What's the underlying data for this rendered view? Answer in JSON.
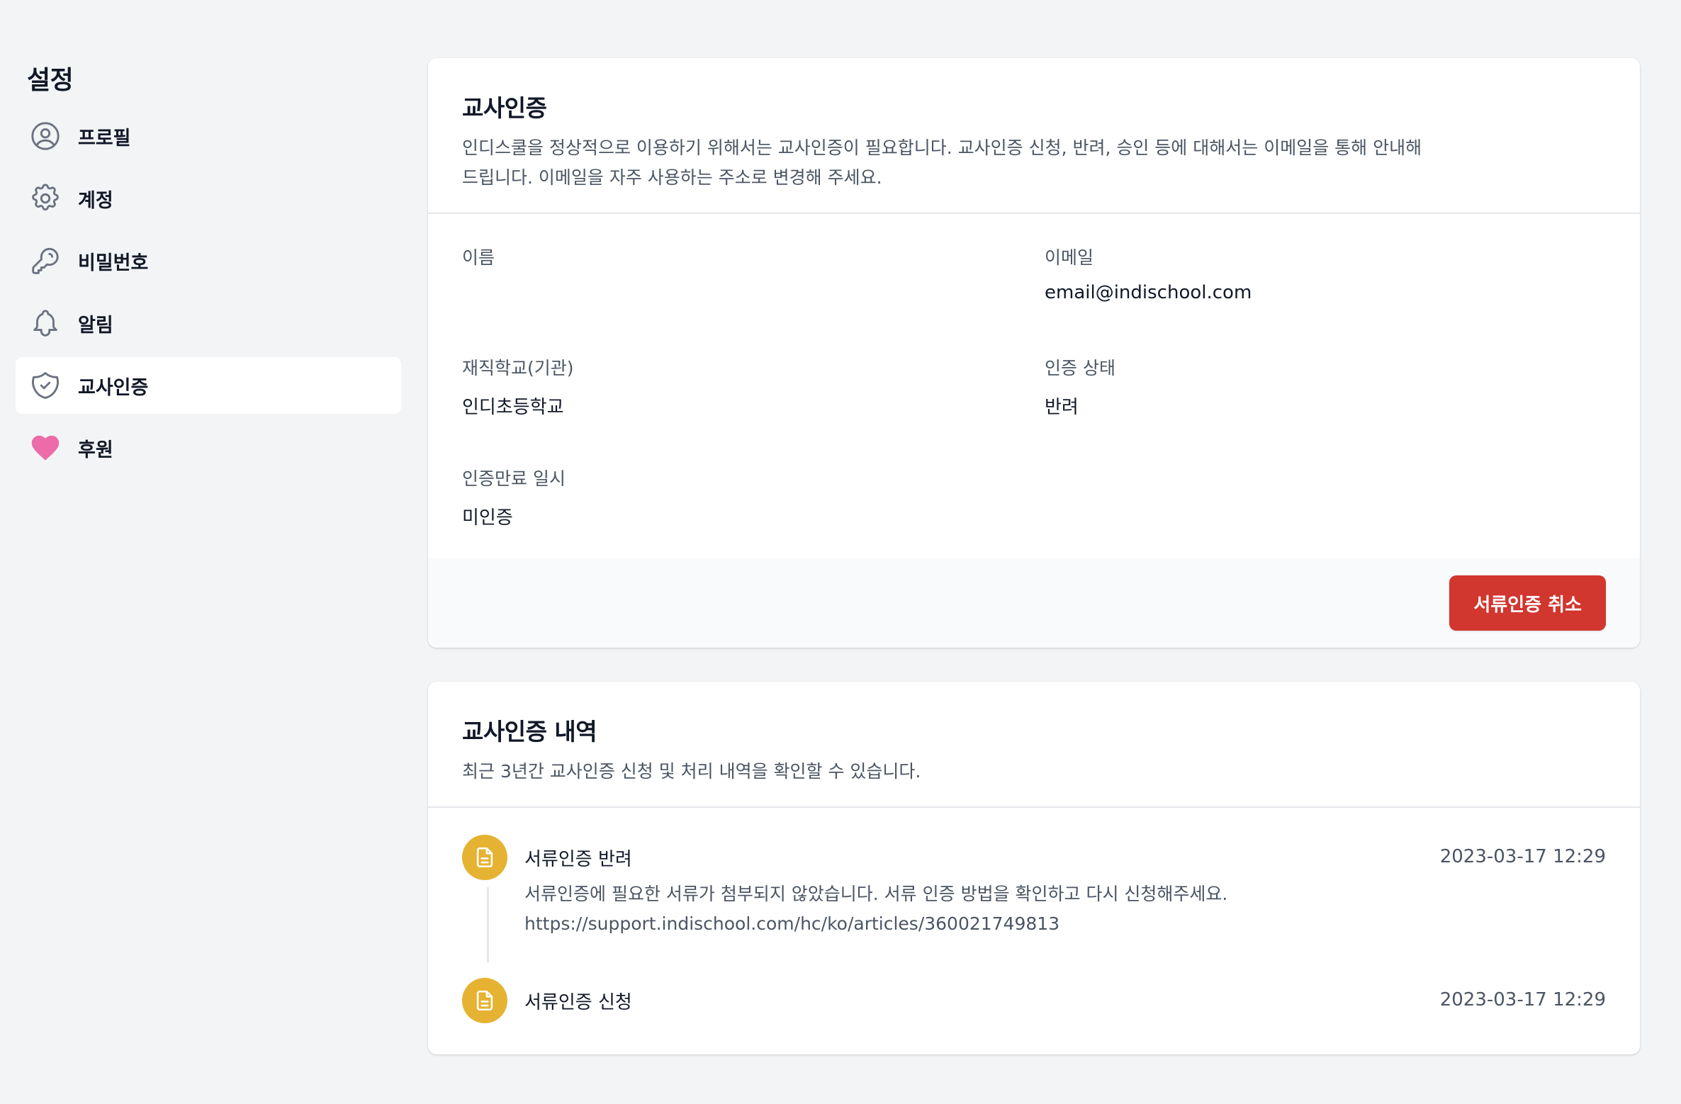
{
  "sidebar": {
    "title": "설정",
    "items": [
      {
        "label": "프로필",
        "icon": "user-circle-icon"
      },
      {
        "label": "계정",
        "icon": "gear-icon"
      },
      {
        "label": "비밀번호",
        "icon": "key-icon"
      },
      {
        "label": "알림",
        "icon": "bell-icon"
      },
      {
        "label": "교사인증",
        "icon": "badge-check-icon"
      },
      {
        "label": "후원",
        "icon": "heart-icon"
      }
    ]
  },
  "verification": {
    "title": "교사인증",
    "description": "인디스쿨을 정상적으로 이용하기 위해서는 교사인증이 필요합니다. 교사인증 신청, 반려, 승인 등에 대해서는 이메일을 통해 안내해 드립니다. 이메일을 자주 사용하는 주소로 변경해 주세요.",
    "fields": {
      "name_label": "이름",
      "name_value": "",
      "email_label": "이메일",
      "email_value": "email@indischool.com",
      "school_label": "재직학교(기관)",
      "school_value": "인디초등학교",
      "status_label": "인증 상태",
      "status_value": "반려",
      "expiry_label": "인증만료 일시",
      "expiry_value": "미인증"
    },
    "cancel_button": "서류인증 취소"
  },
  "history": {
    "title": "교사인증 내역",
    "description": "최근 3년간 교사인증 신청 및 처리 내역을 확인할 수 있습니다.",
    "items": [
      {
        "title": "서류인증 반려",
        "message": "서류인증에 필요한 서류가 첨부되지 않았습니다. 서류 인증 방법을 확인하고 다시 신청해주세요.",
        "link": "https://support.indischool.com/hc/ko/articles/360021749813",
        "time": "2023-03-17 12:29"
      },
      {
        "title": "서류인증 신청",
        "time": "2023-03-17 12:29"
      }
    ]
  },
  "colors": {
    "accent_danger": "#d1362f",
    "timeline_dot": "#e6b232",
    "heart": "#ec6ba8"
  }
}
